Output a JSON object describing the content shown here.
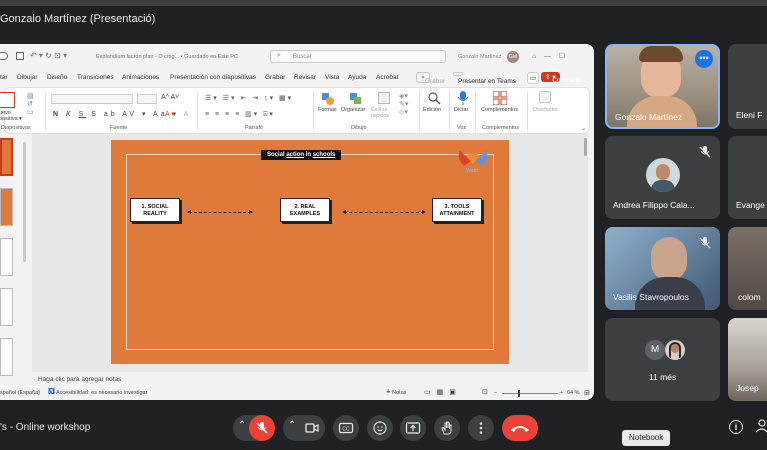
{
  "meeting": {
    "title": "Gonzalo Martínez (Presentació)",
    "name": "'s - Online workshop"
  },
  "ppt": {
    "file_title": "Explandíum lacron plan - O cmg... • Guardado en Este PC",
    "search_placeholder": "Buscar",
    "user_name": "Gonzalo Martínez",
    "user_initials": "GM",
    "tabs": [
      "tar",
      "Dibujar",
      "Diseño",
      "Transiciones",
      "Animaciones",
      "Presentación con diapositivas",
      "Grabar",
      "Revisar",
      "Vista",
      "Ayuda",
      "Acrobat"
    ],
    "record_label": "Grabar",
    "present_teams_label": "Presentar en Teams",
    "share_label": "Compartir",
    "groups": {
      "diapositivas": "Diapositivas",
      "fuente": "Fuente",
      "parrafo": "Párrafo",
      "dibujo": "Dibujo",
      "voz": "Voz",
      "complementos": "Complementos"
    },
    "ribbon_buttons": {
      "nueva": "Nueva diapositiva",
      "formas": "Formas",
      "organizar": "Organizar",
      "estilos": "Estilos rápidos",
      "edicion": "Edición",
      "dictar": "Dictar",
      "complementos": "Complementos",
      "disenador": "Diseñador"
    },
    "notes_placeholder": "Haga clic para agregar notas",
    "status": {
      "language": "spañol (España)",
      "accessibility": "Accesibilidad: es necesario investigar",
      "notes_label": "Notas",
      "zoom": "64 %"
    }
  },
  "slide": {
    "title_prefix": "Social ",
    "title_word1": "action",
    "title_mid": " in ",
    "title_word2": "schools",
    "logo_text": "Voter",
    "boxes": [
      {
        "line1": "1. SOCIAL",
        "line2": "REALITY"
      },
      {
        "line1": "2. REAL",
        "line2": "EXAMPLES"
      },
      {
        "line1": "3. TOOLS",
        "line2": "ATTAINMENT"
      }
    ]
  },
  "participants": [
    {
      "name": "Gonzalo Martínez",
      "speaking": true
    },
    {
      "name": "Eleni F"
    },
    {
      "name": "Andrea Filippo Cala..."
    },
    {
      "name": "Evange"
    },
    {
      "name": "Vasilis Stavropoulos"
    },
    {
      "name": "colom"
    },
    {
      "name": "11 més",
      "initial": "M"
    },
    {
      "name": "Josep"
    }
  ],
  "tooltip": "Notebook",
  "colors": {
    "meet_bg": "#202124",
    "tile_bg": "#3c4043",
    "slide_orange": "#e07a3a",
    "hangup_red": "#ea4335",
    "speaking_blue": "#8ab4f8"
  }
}
